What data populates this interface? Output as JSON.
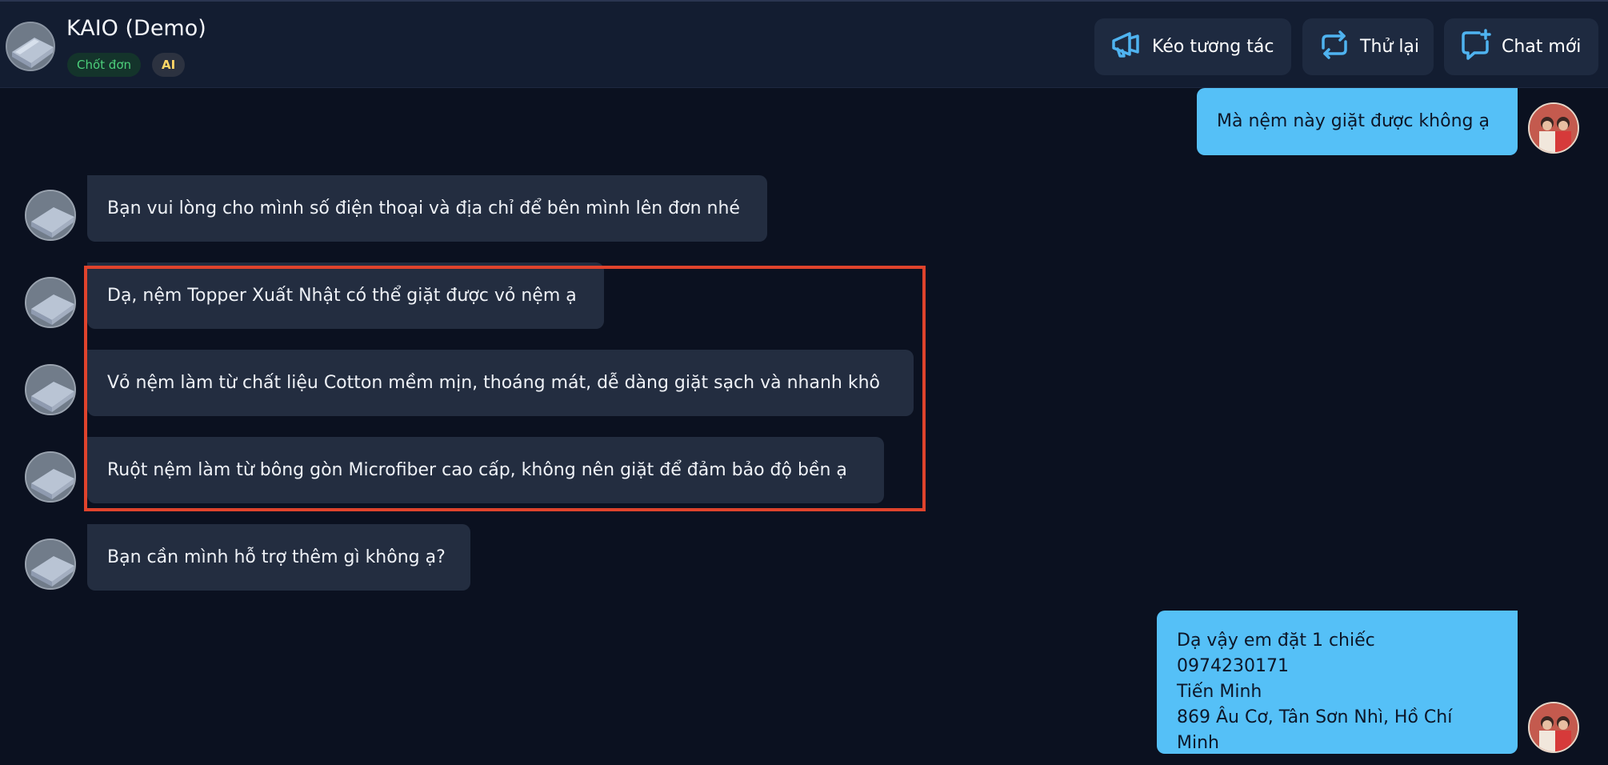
{
  "header": {
    "shop_name": "KAIO (Demo)",
    "badge_status": "Chốt đơn",
    "badge_ai": "AI",
    "buttons": [
      {
        "label": "Kéo tương tác",
        "icon": "megaphone-icon"
      },
      {
        "label": "Thử lại",
        "icon": "retry-icon"
      },
      {
        "label": "Chat mới",
        "icon": "new-chat-icon"
      }
    ]
  },
  "messages": [
    {
      "from": "user",
      "text": "Mà nệm này giặt được không ạ"
    },
    {
      "from": "bot",
      "text": "Bạn vui lòng cho mình số điện thoại và địa chỉ để bên mình lên đơn nhé"
    },
    {
      "from": "bot",
      "text": "Dạ, nệm Topper Xuất Nhật có thể giặt được vỏ nệm ạ"
    },
    {
      "from": "bot",
      "text": "Vỏ nệm làm từ chất liệu Cotton mềm mịn, thoáng mát, dễ dàng giặt sạch và nhanh khô"
    },
    {
      "from": "bot",
      "text": "Ruột nệm làm từ bông gòn Microfiber cao cấp, không nên giặt để đảm bảo độ bền ạ"
    },
    {
      "from": "bot",
      "text": "Bạn cần mình hỗ trợ thêm gì không ạ?"
    },
    {
      "from": "user",
      "lines": [
        "Dạ vậy em đặt 1 chiếc",
        "0974230171",
        "Tiến Minh",
        "869 Âu Cơ, Tân Sơn Nhì, Hồ Chí Minh"
      ]
    }
  ],
  "colors": {
    "background": "#0b1120",
    "header": "#131d31",
    "bot_bubble": "#232d40",
    "user_bubble": "#55c0f7",
    "highlight": "#e0432c",
    "icon_accent": "#4fb3f0"
  }
}
